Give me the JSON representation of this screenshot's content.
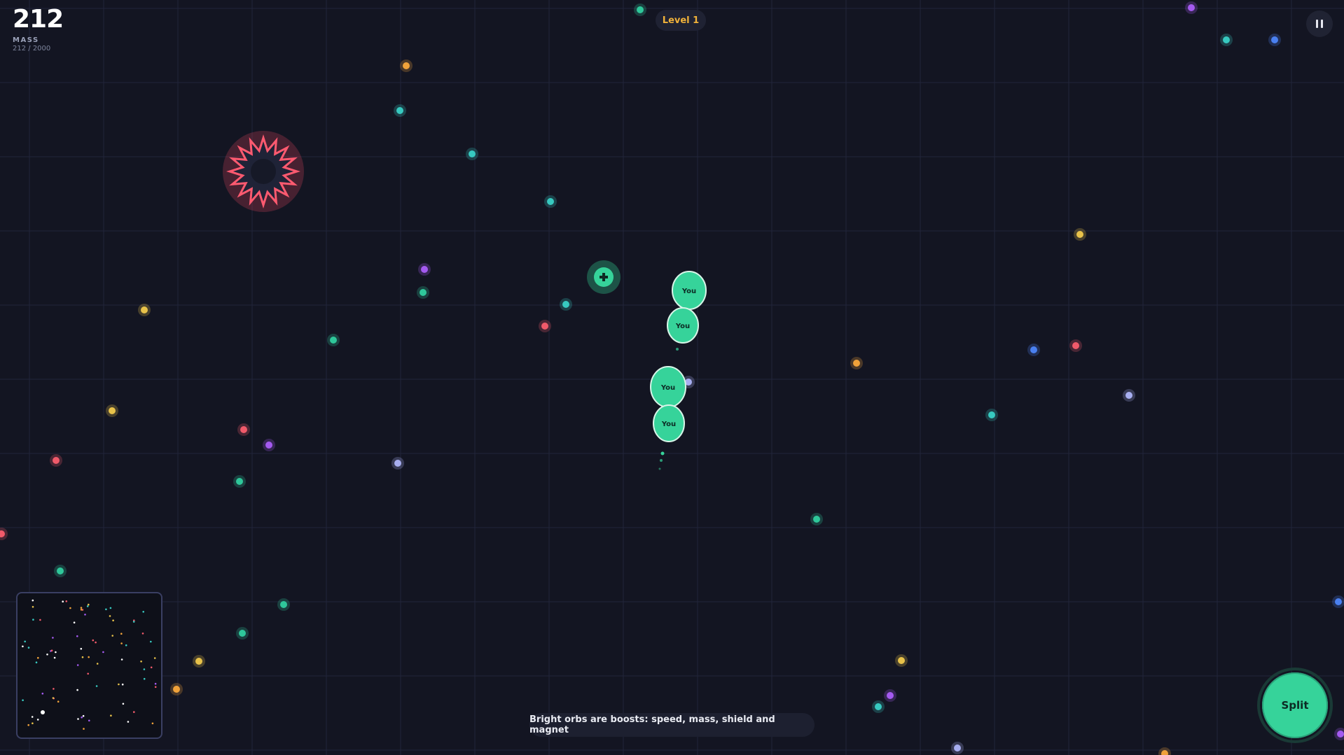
{
  "hud": {
    "mass_value": "212",
    "mass_label": "MASS",
    "mass_progress": "212 / 2000",
    "level_label": "Level 1",
    "pause_icon": "pause-icon"
  },
  "player": {
    "cell_label": "You"
  },
  "hint_text": "Bright orbs are boosts: speed, mass, shield and magnet",
  "split_label": "Split",
  "colors": {
    "background": "#131522",
    "grid": "#23263a",
    "player": "#36d39a",
    "level_text": "#f0b23a",
    "hazard": "#e2485f"
  },
  "icons": {
    "hazard": "spiked-virus-icon",
    "boost": "plus-boost-icon"
  }
}
